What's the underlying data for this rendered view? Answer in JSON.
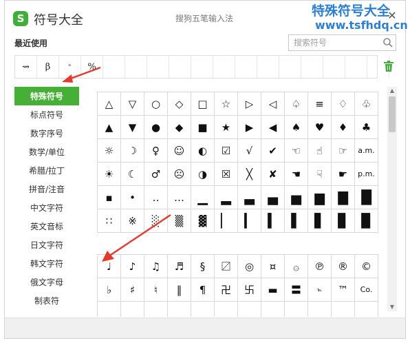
{
  "app": {
    "logo": "S",
    "title": "符号大全",
    "ime_name": "搜狗五笔输入法"
  },
  "watermark": {
    "line1": "特殊符号大全",
    "line2": "www.tsfhdq.cn"
  },
  "window_controls": {
    "minimize": "–",
    "close": "✕"
  },
  "recent": {
    "label": "最近使用",
    "items": [
      "⇝",
      "β",
      "ⁿ",
      "%",
      "",
      "",
      "",
      "",
      "",
      "",
      "",
      "",
      "",
      "",
      "",
      "",
      ""
    ],
    "trash_icon": "trash-icon"
  },
  "search": {
    "placeholder": "搜索符号",
    "value": "",
    "icon": "search-icon"
  },
  "sidebar": {
    "active_color": "#45b035",
    "categories": [
      "特殊符号",
      "标点符号",
      "数字序号",
      "数学/单位",
      "希腊/拉丁",
      "拼音/注音",
      "中文字符",
      "英文音标",
      "日文字符",
      "韩文字符",
      "俄文字母",
      "制表符"
    ]
  },
  "symbols": {
    "group1": [
      [
        "△",
        "▽",
        "○",
        "◇",
        "□",
        "☆",
        "▷",
        "◁",
        "♤",
        "≡",
        "♢",
        "♧"
      ],
      [
        "▲",
        "▼",
        "●",
        "◆",
        "■",
        "★",
        "▶",
        "◀",
        "♠",
        "♥",
        "♦",
        "♣"
      ],
      [
        "☼",
        "☽",
        "♀",
        "☺",
        "◐",
        "☑",
        "√",
        "✔",
        "☜",
        "☝",
        "☞",
        "a.m."
      ],
      [
        "☀",
        "☾",
        "♂",
        "☹",
        "◑",
        "☒",
        "╳",
        "✘",
        "☚",
        "☟",
        "☛",
        "p.m."
      ],
      [
        "▪",
        "•",
        "‥",
        "…",
        "▁",
        "▂",
        "▃",
        "▄",
        "▅",
        "▆",
        "▇",
        "█"
      ],
      [
        "∷",
        "※",
        "░",
        "▒",
        "▓",
        "▏",
        "▎",
        "▍",
        "▌",
        "▋",
        "▊",
        "▉"
      ]
    ],
    "group2": [
      [
        "♩",
        "♪",
        "♫",
        "♬",
        "§",
        "〼",
        "◎",
        "¤",
        "۞",
        "℗",
        "®",
        "©"
      ],
      [
        "♭",
        "♯",
        "♮",
        "‖",
        "¶",
        "卍",
        "卐",
        "▬",
        "〓",
        "℡",
        "™",
        "Co."
      ],
      [
        "",
        "",
        "",
        "",
        "",
        "",
        "",
        "",
        "",
        "",
        "",
        ""
      ]
    ]
  }
}
